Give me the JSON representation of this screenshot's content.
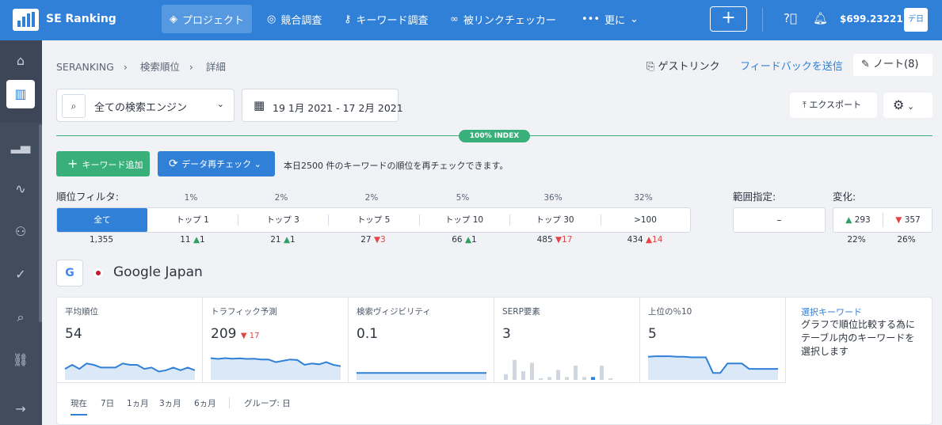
{
  "header": {
    "brand": "SE Ranking",
    "nav": [
      "プロジェクト",
      "競合調査",
      "キーワード調査",
      "被リンクチェッカー",
      "更に"
    ],
    "plus_label": "+",
    "balance": "$699.23221",
    "lang": "デ日"
  },
  "breadcrumb": [
    "SERANKING",
    "検索順位",
    "詳細"
  ],
  "top_links": {
    "guest": "ゲストリンク",
    "feedback": "フィードバックを送信",
    "notes": "ノート(8)"
  },
  "controls": {
    "engine": "全ての検索エンジン",
    "date": "19 1月 2021 - 17 2月 2021",
    "export": "エクスポート",
    "index_badge": "100% INDEX",
    "add_keyword": "キーワード追加",
    "recheck": "データ再チェック",
    "recheck_note": "本日2500 件のキーワードの順位を再チェックできます。"
  },
  "filter": {
    "label": "順位フィルタ:",
    "segments": [
      {
        "label": "全て",
        "pct": "",
        "count": "1,355",
        "delta": "",
        "dir": ""
      },
      {
        "label": "トップ 1",
        "pct": "1%",
        "count": "11",
        "delta": "1",
        "dir": "up"
      },
      {
        "label": "トップ 3",
        "pct": "2%",
        "count": "21",
        "delta": "1",
        "dir": "up"
      },
      {
        "label": "トップ 5",
        "pct": "2%",
        "count": "27",
        "delta": "3",
        "dir": "down"
      },
      {
        "label": "トップ 10",
        "pct": "5%",
        "count": "66",
        "delta": "1",
        "dir": "up"
      },
      {
        "label": "トップ 30",
        "pct": "36%",
        "count": "485",
        "delta": "17",
        "dir": "down"
      },
      {
        "label": ">100",
        "pct": "32%",
        "count": "434",
        "delta": "14",
        "dir": "down"
      }
    ],
    "range_label": "範囲指定:",
    "range_value": "–",
    "change_label": "変化:",
    "change_up": "293",
    "change_down": "357",
    "change_up_pct": "22%",
    "change_down_pct": "26%"
  },
  "engine_block": {
    "name": "Google Japan",
    "g": "G"
  },
  "metrics": [
    {
      "title": "平均順位",
      "value": "54",
      "delta": "",
      "spark": [
        0.35,
        0.5,
        0.35,
        0.55,
        0.5,
        0.4,
        0.4,
        0.4,
        0.55,
        0.5,
        0.5,
        0.35,
        0.4,
        0.25,
        0.3,
        0.4,
        0.3,
        0.4,
        0.3
      ]
    },
    {
      "title": "トラフィック予測",
      "value": "209",
      "delta": "17",
      "spark": [
        0.75,
        0.72,
        0.75,
        0.73,
        0.74,
        0.72,
        0.73,
        0.7,
        0.7,
        0.6,
        0.65,
        0.7,
        0.68,
        0.5,
        0.55,
        0.52,
        0.6,
        0.5,
        0.45
      ]
    },
    {
      "title": "検索ヴィジビリティ",
      "value": "0.1",
      "delta": "",
      "spark": [
        0.2,
        0.2,
        0.2,
        0.2,
        0.2,
        0.2,
        0.2,
        0.2,
        0.2,
        0.2,
        0.2,
        0.2,
        0.2,
        0.2,
        0.2,
        0.2,
        0.2,
        0.2,
        0.2
      ]
    },
    {
      "title": "SERP要素",
      "value": "3",
      "delta": "",
      "bars": [
        0.2,
        0.7,
        0.3,
        0.6,
        0,
        0.1,
        0.35,
        0.1,
        0.5,
        0.1,
        0.1,
        0.5,
        0
      ]
    },
    {
      "title": "上位の％10",
      "value": "5",
      "delta": "",
      "spark": [
        0.8,
        0.82,
        0.82,
        0.82,
        0.8,
        0.8,
        0.78,
        0.78,
        0.78,
        0.2,
        0.2,
        0.55,
        0.55,
        0.55,
        0.35,
        0.35,
        0.35,
        0.35,
        0.35
      ]
    }
  ],
  "select_kw": {
    "title": "選択キーワード",
    "desc": "グラフで順位比較する為にテーブル内のキーワードを選択します"
  },
  "period_tabs": [
    "現在",
    "7日",
    "1ヵ月",
    "3ヵ月",
    "6ヵ月"
  ],
  "group": "グループ: 日"
}
